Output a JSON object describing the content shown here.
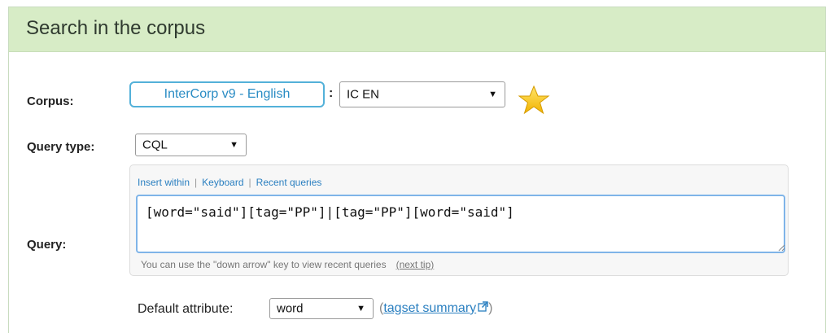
{
  "header": {
    "title": "Search in the corpus"
  },
  "corpus": {
    "label": "Corpus:",
    "button_label": "InterCorp v9 - English",
    "separator": ":",
    "select_value": "IC EN",
    "star_icon": "star-icon"
  },
  "query_type": {
    "label": "Query type:",
    "select_value": "CQL"
  },
  "query": {
    "label": "Query:",
    "links": [
      "Insert within",
      "Keyboard",
      "Recent queries"
    ],
    "value": "[word=\"said\"][tag=\"PP\"]|[tag=\"PP\"][word=\"said\"]",
    "hint": "You can use the \"down arrow\" key to view recent queries",
    "next_tip": "(next tip)"
  },
  "default_attribute": {
    "label": "Default attribute:",
    "select_value": "word",
    "tagset_open": "(",
    "tagset_link": "tagset summary",
    "tagset_close": ")"
  },
  "colors": {
    "header_bg": "#d7ecc6",
    "accent": "#53b1d9",
    "link": "#2a7fc0"
  }
}
